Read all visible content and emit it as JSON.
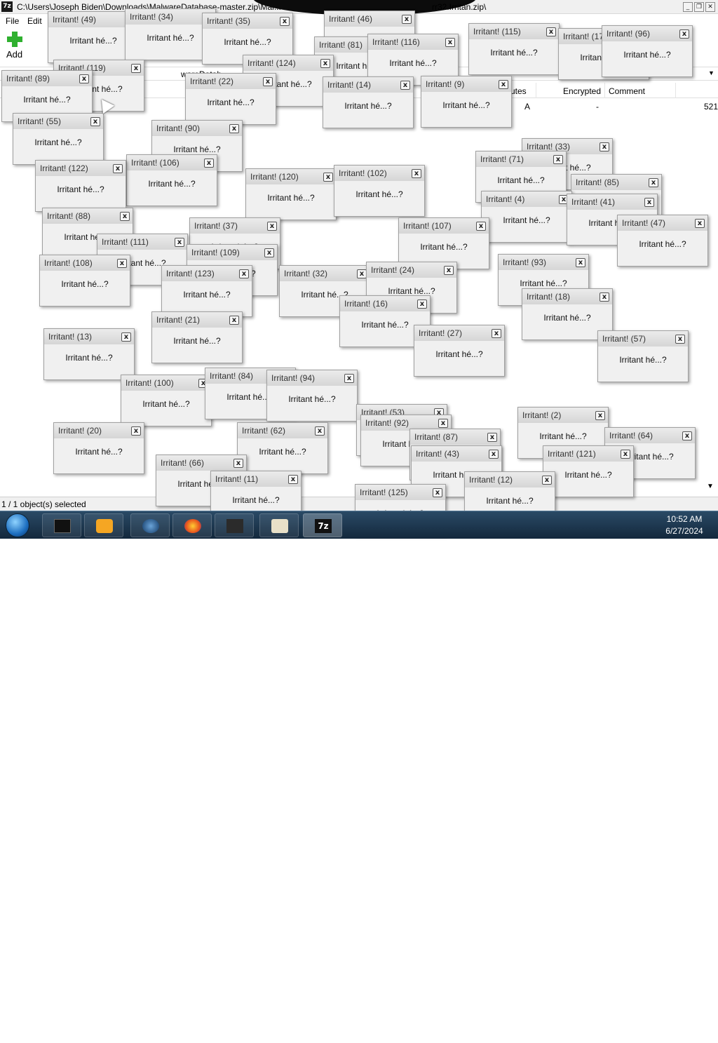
{
  "window": {
    "title": "C:\\Users\\Joseph Biden\\Downloads\\MalwareDatabase-master.zip\\Mal...",
    "title_tail": "rr32.Irritan.zip\\",
    "app_icon": "7z"
  },
  "menu": [
    "File",
    "Edit"
  ],
  "toolbar": {
    "add_label": "Add"
  },
  "addressbar": {
    "partial": "wareDatab"
  },
  "columns": [
    "utes",
    "Encrypted",
    "Comment"
  ],
  "row": {
    "attributes": "A",
    "encrypted": "-",
    "size_partial": "521"
  },
  "status": {
    "text": "1 / 1 object(s) selected"
  },
  "popup": {
    "message": "Irritant hé...?",
    "close_glyph": "x"
  },
  "popups": [
    {
      "title": "Irritant! (49)"
    },
    {
      "title": "Irritant! (34)"
    },
    {
      "title": "Irritant! (35)"
    },
    {
      "title": "Irritant! (46)"
    },
    {
      "title": "Irritant! (115)"
    },
    {
      "title": "Irritant! (17)"
    },
    {
      "title": "Irritant! (96)"
    },
    {
      "title": "Irritant! (81)"
    },
    {
      "title": "Irritant! (116)"
    },
    {
      "title": "Irritant! (124)"
    },
    {
      "title": "Irritant! (119)"
    },
    {
      "title": "Irritant! (89)"
    },
    {
      "title": "Irritant! (22)"
    },
    {
      "title": "Irritant! (14)"
    },
    {
      "title": "Irritant! (9)"
    },
    {
      "title": "Irritant! (55)"
    },
    {
      "title": "Irritant! (90)"
    },
    {
      "title": "Irritant! (33)"
    },
    {
      "title": "Irritant! (106)"
    },
    {
      "title": "Irritant! (122)"
    },
    {
      "title": "Irritant! (71)"
    },
    {
      "title": "Irritant! (85)"
    },
    {
      "title": "Irritant! (120)"
    },
    {
      "title": "Irritant! (102)"
    },
    {
      "title": "Irritant! (4)"
    },
    {
      "title": "Irritant! (41)"
    },
    {
      "title": "Irritant! (88)"
    },
    {
      "title": "Irritant! (37)"
    },
    {
      "title": "Irritant! (107)"
    },
    {
      "title": "Irritant! (47)"
    },
    {
      "title": "Irritant! (111)"
    },
    {
      "title": "Irritant! (109)"
    },
    {
      "title": "Irritant! (108)"
    },
    {
      "title": "Irritant! (123)"
    },
    {
      "title": "Irritant! (32)"
    },
    {
      "title": "Irritant! (24)"
    },
    {
      "title": "Irritant! (93)"
    },
    {
      "title": "Irritant! (18)"
    },
    {
      "title": "Irritant! (16)"
    },
    {
      "title": "Irritant! (21)"
    },
    {
      "title": "Irritant! (13)"
    },
    {
      "title": "Irritant! (27)"
    },
    {
      "title": "Irritant! (57)"
    },
    {
      "title": "Irritant! (100)"
    },
    {
      "title": "Irritant! (84)"
    },
    {
      "title": "Irritant! (94)"
    },
    {
      "title": "Irritant! (53)"
    },
    {
      "title": "Irritant! (2)"
    },
    {
      "title": "Irritant! (92)"
    },
    {
      "title": "Irritant! (20)"
    },
    {
      "title": "Irritant! (62)"
    },
    {
      "title": "Irritant! (87)"
    },
    {
      "title": "Irritant! (64)"
    },
    {
      "title": "Irritant! (43)"
    },
    {
      "title": "Irritant! (121)"
    },
    {
      "title": "Irritant! (66)"
    },
    {
      "title": "Irritant! (11)"
    },
    {
      "title": "Irritant! (12)"
    },
    {
      "title": "Irritant! (125)"
    }
  ],
  "clock": {
    "time": "10:52 AM",
    "date": "6/27/2024"
  },
  "taskbar": [
    "start-orb",
    "terminal-icon",
    "media-player-icon",
    "globe-icon",
    "firefox-icon",
    "explorer-icon",
    "installer-icon",
    "7zip-icon"
  ]
}
